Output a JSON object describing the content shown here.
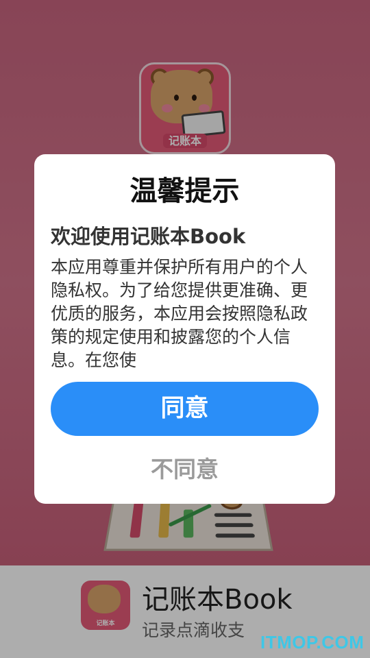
{
  "splash": {
    "logo_label": "记账本"
  },
  "dialog": {
    "title": "温馨提示",
    "subtitle": "欢迎使用记账本Book",
    "body": "本应用尊重并保护所有用户的个人隐私权。为了给您提供更准确、更优质的服务，本应用会按照隐私政策的规定使用和披露您的个人信息。在您使",
    "agree_label": "同意",
    "disagree_label": "不同意"
  },
  "brand": {
    "logo_label": "记账本",
    "title": "记账本Book",
    "subtitle": "记录点滴收支"
  },
  "watermark": "ITMOP.COM",
  "colors": {
    "accent": "#2a8ef8",
    "splash_bg": "#c9657f",
    "watermark": "#3fc7e6"
  }
}
